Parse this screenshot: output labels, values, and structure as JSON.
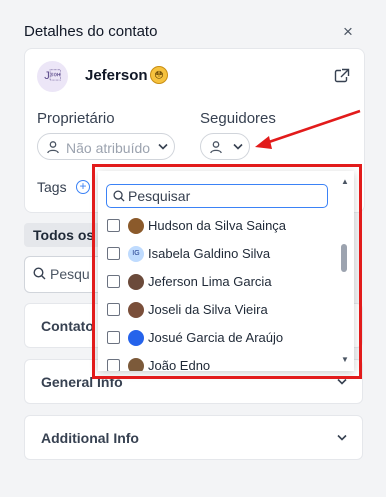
{
  "header": {
    "title": "Detalhes do contato",
    "close": "×"
  },
  "contact": {
    "initials": "J\u0001",
    "name": "Jeferson",
    "emoji": "😳"
  },
  "owner": {
    "label": "Proprietário",
    "placeholder": "Não atribuído"
  },
  "followers": {
    "label": "Seguidores"
  },
  "tags": {
    "label": "Tags",
    "add": "+"
  },
  "tabs": {
    "active": "Todos os"
  },
  "search": {
    "placeholder": "Pesqu"
  },
  "sections": [
    {
      "title": "Contato"
    },
    {
      "title": "General Info"
    },
    {
      "title": "Additional Info"
    }
  ],
  "dropdown": {
    "search_placeholder": "Pesquisar",
    "options": [
      {
        "name": "Hudson da Silva Sainça",
        "avatar": "",
        "color": "#8b5a2b"
      },
      {
        "name": "Isabela Galdino Silva",
        "avatar": "IG",
        "color": "#bfdbfe"
      },
      {
        "name": "Jeferson Lima Garcia",
        "avatar": "",
        "color": "#6b4a3a"
      },
      {
        "name": "Joseli da Silva Vieira",
        "avatar": "",
        "color": "#7a4f3a"
      },
      {
        "name": "Josué Garcia de Araújo",
        "avatar": "",
        "color": "#2563eb"
      },
      {
        "name": "João Edno",
        "avatar": "",
        "color": "#7c5a3a"
      }
    ]
  },
  "colors": {
    "accent": "#3b82f6",
    "highlight": "#e21b1b"
  },
  "icons": [
    "close-icon",
    "external-link-icon",
    "user-icon",
    "chevron-down-icon",
    "plus-circle-icon",
    "search-icon",
    "checkbox",
    "scroll-arrow-up-icon",
    "scroll-arrow-down-icon"
  ]
}
